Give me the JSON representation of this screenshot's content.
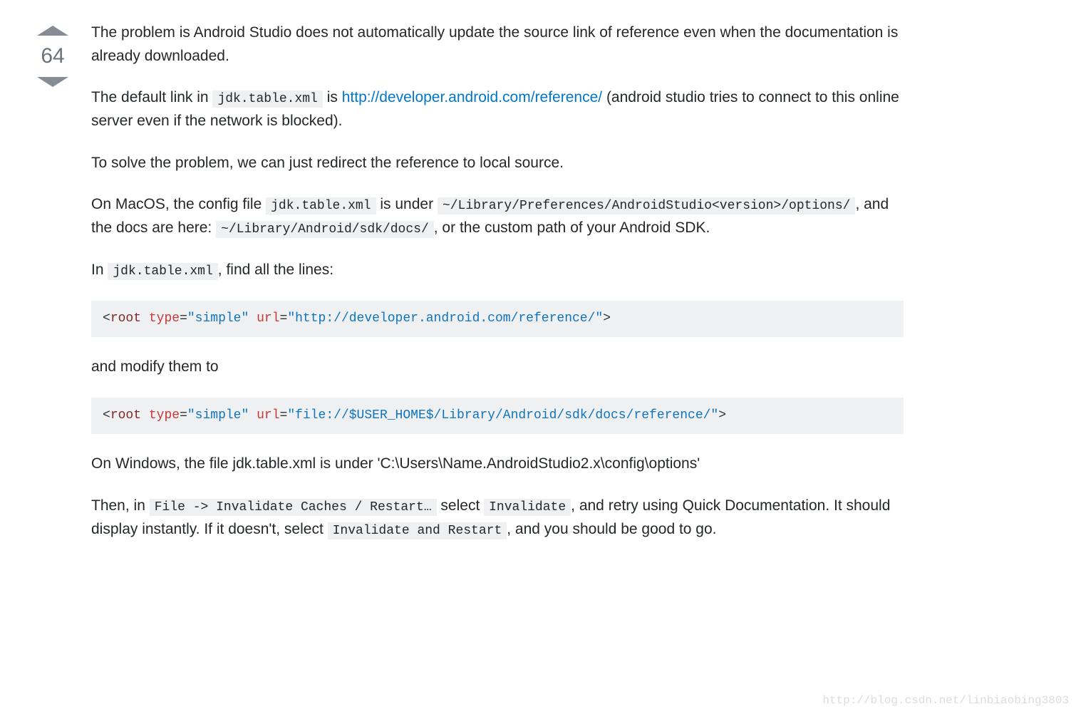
{
  "vote": {
    "count": "64"
  },
  "p1": {
    "text": "The problem is Android Studio does not automatically update the source link of reference even when the documentation is already downloaded."
  },
  "p2": {
    "t1": "The default link in ",
    "code1": "jdk.table.xml",
    "t2": " is ",
    "link_text": "http://developer.android.com/reference/",
    "t3": " (android studio tries to connect to this online server even if the network is blocked)."
  },
  "p3": {
    "text": "To solve the problem, we can just redirect the reference to local source."
  },
  "p4": {
    "t1": "On MacOS, the config file ",
    "code1": "jdk.table.xml",
    "t2": " is under ",
    "code2": "~/Library/Preferences/AndroidStudio<version>/options/",
    "t3": ", and the docs are here: ",
    "code3": "~/Library/Android/sdk/docs/",
    "t4": ", or the custom path of your Android SDK."
  },
  "p5": {
    "t1": "In ",
    "code1": "jdk.table.xml",
    "t2": ", find all the lines:"
  },
  "code1": {
    "open": "<",
    "tag": "root",
    "sp1": " ",
    "attr1": "type",
    "eq1": "=",
    "val1": "\"simple\"",
    "sp2": " ",
    "attr2": "url",
    "eq2": "=",
    "val2": "\"http://developer.android.com/reference/\"",
    "close": ">"
  },
  "p6": {
    "text": "and modify them to"
  },
  "code2": {
    "open": "<",
    "tag": "root",
    "sp1": " ",
    "attr1": "type",
    "eq1": "=",
    "val1": "\"simple\"",
    "sp2": " ",
    "attr2": "url",
    "eq2": "=",
    "val2": "\"file://$USER_HOME$/Library/Android/sdk/docs/reference/\"",
    "close": ">"
  },
  "p7": {
    "text": "On Windows, the file jdk.table.xml is under 'C:\\Users\\Name.AndroidStudio2.x\\config\\options'"
  },
  "p8": {
    "t1": "Then, in ",
    "code1": "File -> Invalidate Caches / Restart…",
    "t2": " select ",
    "code2": "Invalidate",
    "t3": ", and retry using Quick Documentation. It should display instantly. If it doesn't, select ",
    "code3": "Invalidate and Restart",
    "t4": ", and you should be good to go."
  },
  "watermark": "http://blog.csdn.net/linbiaobing3803"
}
